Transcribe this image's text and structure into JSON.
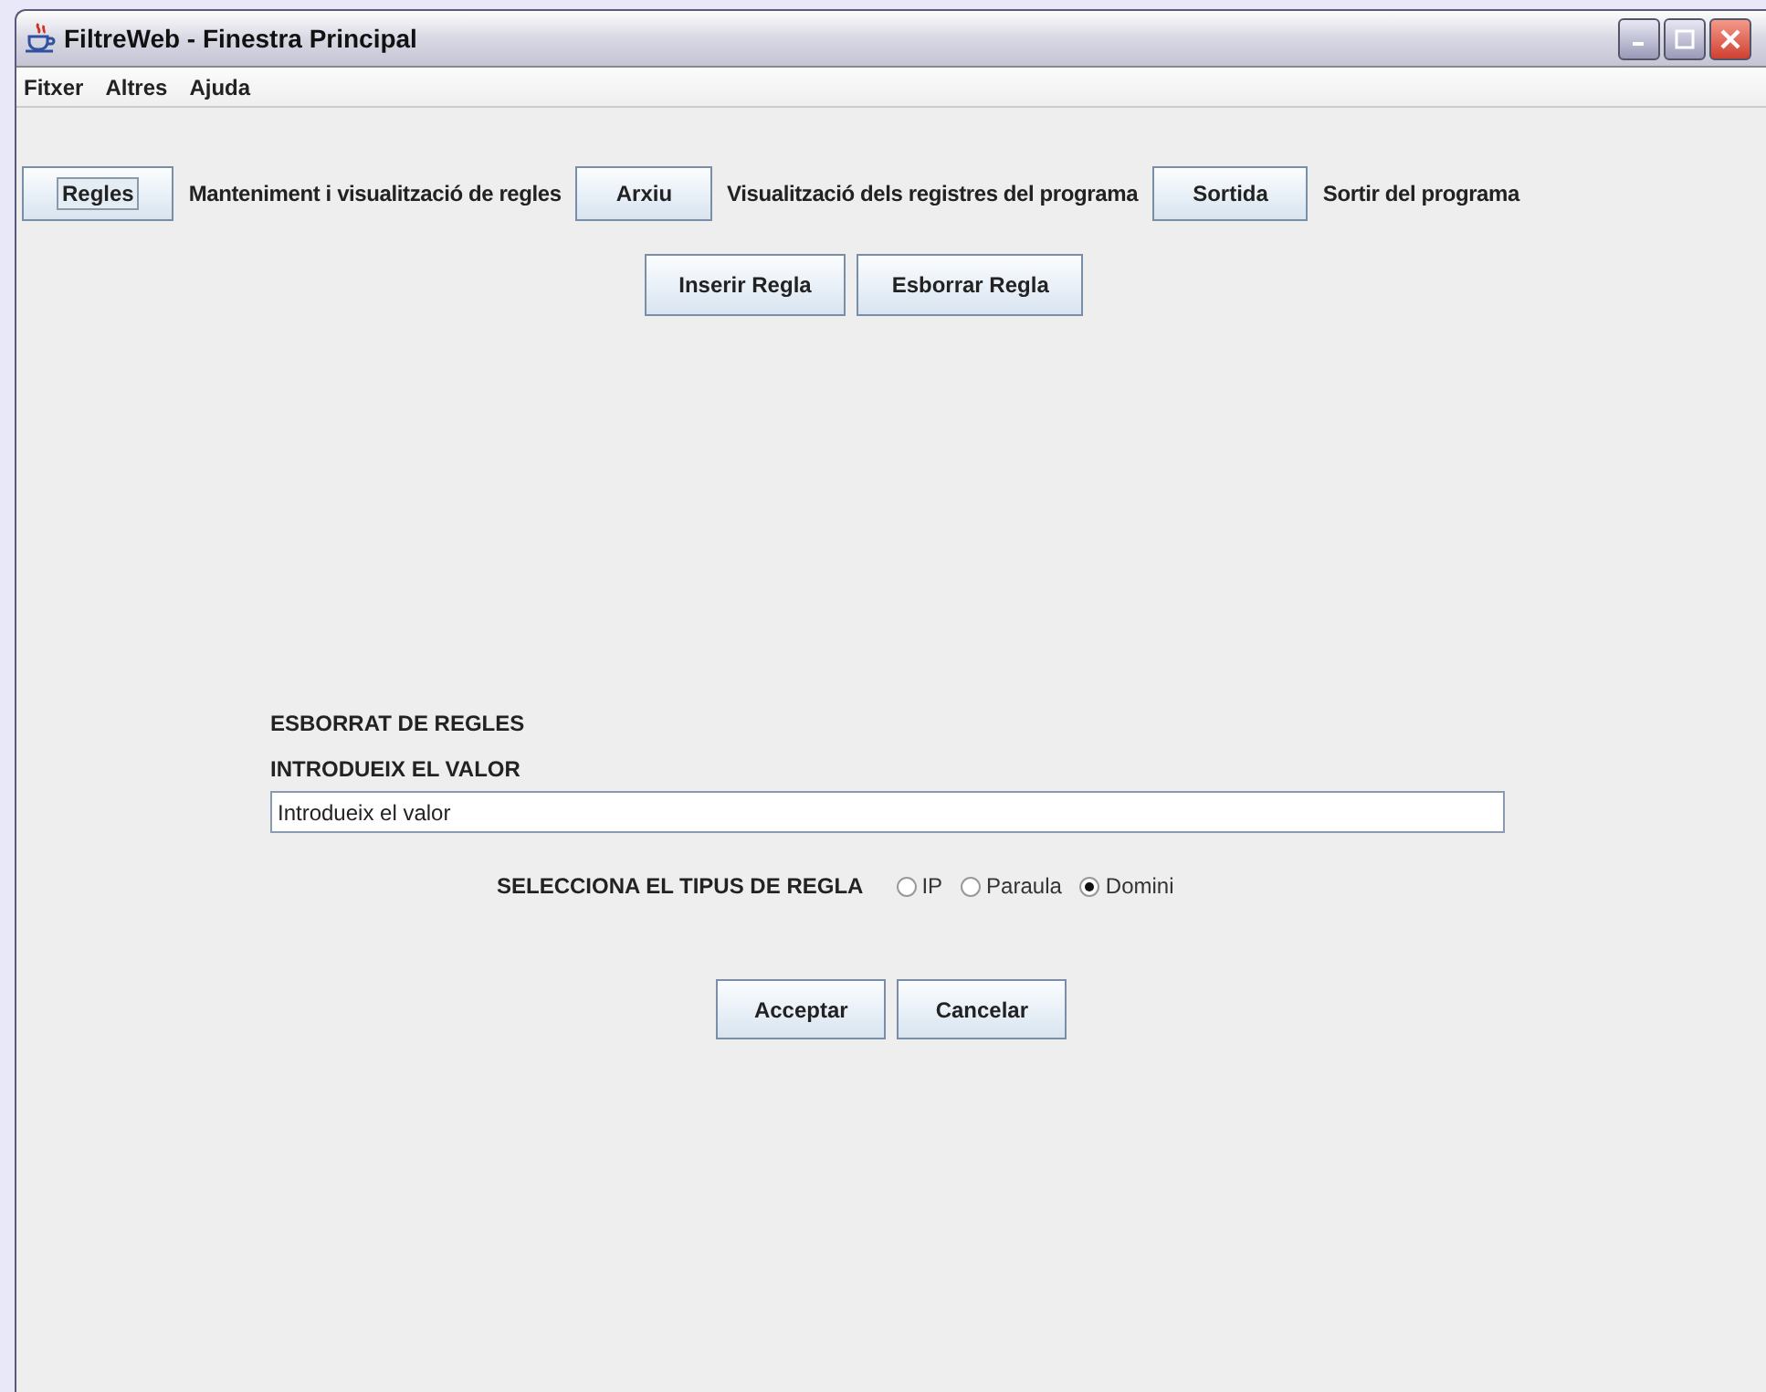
{
  "window": {
    "title": "FiltreWeb - Finestra Principal"
  },
  "menu": [
    "Fitxer",
    "Altres",
    "Ajuda"
  ],
  "toolbar": [
    {
      "button": "Regles",
      "description": "Manteniment i visualització de regles",
      "focused": true
    },
    {
      "button": "Arxiu",
      "description": "Visualització dels registres del programa",
      "focused": false
    },
    {
      "button": "Sortida",
      "description": "Sortir del programa",
      "focused": false
    }
  ],
  "actions": [
    "Inserir Regla",
    "Esborrar Regla"
  ],
  "form": {
    "heading": "ESBORRAT DE REGLES",
    "field_label": "INTRODUEIX EL VALOR",
    "value": "Introdueix el valor",
    "type_label": "SELECCIONA EL TIPUS DE REGLA",
    "types": [
      {
        "label": "IP",
        "selected": false
      },
      {
        "label": "Paraula",
        "selected": false
      },
      {
        "label": "Domini",
        "selected": true
      }
    ]
  },
  "buttons": [
    "Acceptar",
    "Cancelar"
  ]
}
